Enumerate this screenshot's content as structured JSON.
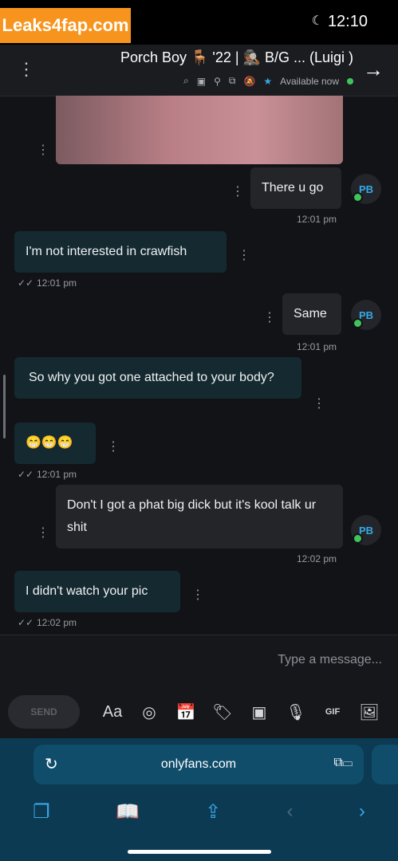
{
  "status": {
    "watermark": "Leaks4fap.com",
    "time": "12:10",
    "moon": "☾"
  },
  "header": {
    "title": "Porch Boy 🪑 '22 | 🕵🏾 B/G ... (Luigi )",
    "availability": "Available now",
    "star": "★",
    "icons": [
      "bell-off-icon",
      "pin-icon",
      "note-icon",
      "image-icon",
      "search-icon"
    ]
  },
  "messages": [
    {
      "kind": "in",
      "text": "There u go",
      "time": "12:01 pm"
    },
    {
      "kind": "out",
      "text": "I'm not interested in crawfish",
      "time": "12:01 pm"
    },
    {
      "kind": "in",
      "text": "Same",
      "time": "12:01 pm"
    },
    {
      "kind": "out",
      "text": "So why you got one attached to your body?"
    },
    {
      "kind": "out",
      "text": "😁😁😁",
      "time": "12:01 pm"
    },
    {
      "kind": "in",
      "text": "Don't I got a phat big dick but it's kool talk ur shit",
      "time": "12:02 pm"
    },
    {
      "kind": "out",
      "text": "I didn't watch your pic",
      "time": "12:02 pm"
    }
  ],
  "avatar_initials": "PB",
  "composer": {
    "placeholder": "Type a message...",
    "send_label": "SEND",
    "tools": [
      "Aa",
      "◎",
      "📅",
      "🏷",
      "▣",
      "🎙",
      "GIF",
      "🖼"
    ]
  },
  "browser": {
    "url": "onlyfans.com",
    "reload": "↻",
    "nav": [
      "❐",
      "📖",
      "⇪",
      "‹",
      "›"
    ]
  },
  "colors": {
    "accent": "#35a9e6",
    "online": "#3ec45a",
    "browser_bar": "#0b3a52"
  }
}
